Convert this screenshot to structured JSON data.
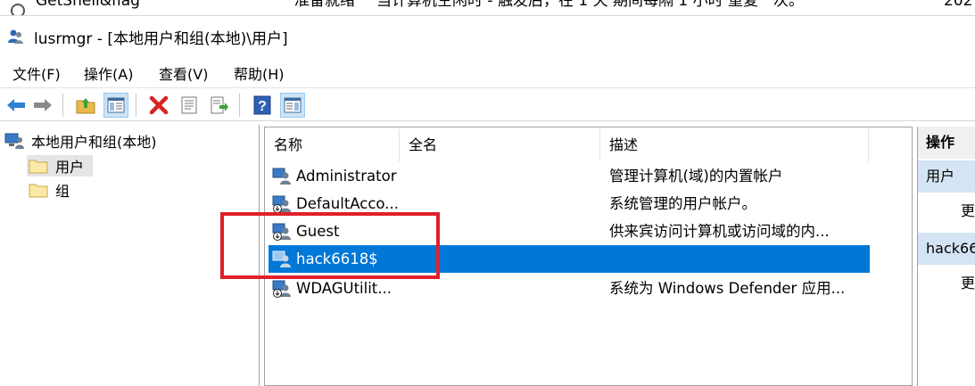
{
  "background_window": {
    "task_name": "GetShell&flag",
    "task_status": "准备就绪",
    "task_trigger": "当计算机空闲时 - 触发后，在 1 天 期间每隔 1 小时 重复一次。",
    "task_date": "202"
  },
  "window": {
    "title": "lusrmgr - [本地用户和组(本地)\\用户]"
  },
  "menu": {
    "items": [
      "文件(F)",
      "操作(A)",
      "查看(V)",
      "帮助(H)"
    ]
  },
  "tree": {
    "root": "本地用户和组(本地)",
    "children": [
      "用户",
      "组"
    ],
    "selected_index": 0
  },
  "list": {
    "columns": [
      "名称",
      "全名",
      "描述"
    ],
    "rows": [
      {
        "name": "Administrator",
        "fullname": "",
        "description": "管理计算机(域)的内置帐户"
      },
      {
        "name": "DefaultAcco...",
        "fullname": "",
        "description": "系统管理的用户帐户。"
      },
      {
        "name": "Guest",
        "fullname": "",
        "description": "供来宾访问计算机或访问域的内..."
      },
      {
        "name": "hack6618$",
        "fullname": "",
        "description": ""
      },
      {
        "name": "WDAGUtilit...",
        "fullname": "",
        "description": "系统为 Windows Defender 应用..."
      }
    ],
    "selected_index": 3
  },
  "actions": {
    "header": "操作",
    "sections": [
      {
        "title": "用户",
        "more": "更"
      },
      {
        "title": "hack66",
        "more": "更"
      }
    ]
  },
  "colors": {
    "selection": "#0078d7",
    "highlight_box": "#e0202a",
    "action_section": "#d4e4f4"
  }
}
